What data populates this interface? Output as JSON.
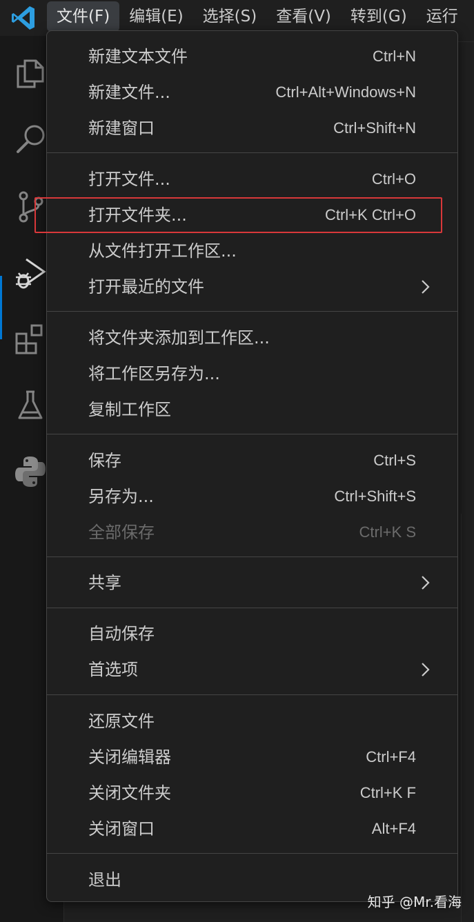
{
  "menubar": {
    "items": [
      {
        "label": "文件(F)",
        "active": true
      },
      {
        "label": "编辑(E)"
      },
      {
        "label": "选择(S)"
      },
      {
        "label": "查看(V)"
      },
      {
        "label": "转到(G)"
      },
      {
        "label": "运行"
      }
    ]
  },
  "activity_icons": [
    "files-icon",
    "search-icon",
    "source-control-icon",
    "run-debug-icon",
    "extensions-icon",
    "testing-flask-icon",
    "python-icon"
  ],
  "file_menu": {
    "items": [
      {
        "label": "新建文本文件",
        "shortcut": "Ctrl+N"
      },
      {
        "label": "新建文件...",
        "shortcut": "Ctrl+Alt+Windows+N"
      },
      {
        "label": "新建窗口",
        "shortcut": "Ctrl+Shift+N"
      },
      {
        "label": "打开文件...",
        "shortcut": "Ctrl+O"
      },
      {
        "label": "打开文件夹...",
        "shortcut": "Ctrl+K Ctrl+O",
        "highlighted": true
      },
      {
        "label": "从文件打开工作区...",
        "shortcut": ""
      },
      {
        "label": "打开最近的文件",
        "shortcut": "",
        "submenu": true
      },
      {
        "label": "将文件夹添加到工作区...",
        "shortcut": ""
      },
      {
        "label": "将工作区另存为...",
        "shortcut": ""
      },
      {
        "label": "复制工作区",
        "shortcut": ""
      },
      {
        "label": "保存",
        "shortcut": "Ctrl+S"
      },
      {
        "label": "另存为...",
        "shortcut": "Ctrl+Shift+S"
      },
      {
        "label": "全部保存",
        "shortcut": "Ctrl+K S",
        "disabled": true
      },
      {
        "label": "共享",
        "shortcut": "",
        "submenu": true
      },
      {
        "label": "自动保存",
        "shortcut": ""
      },
      {
        "label": "首选项",
        "shortcut": "",
        "submenu": true
      },
      {
        "label": "还原文件",
        "shortcut": ""
      },
      {
        "label": "关闭编辑器",
        "shortcut": "Ctrl+F4"
      },
      {
        "label": "关闭文件夹",
        "shortcut": "Ctrl+K F"
      },
      {
        "label": "关闭窗口",
        "shortcut": "Alt+F4"
      },
      {
        "label": "退出",
        "shortcut": ""
      }
    ]
  },
  "colors": {
    "background": "#1f1f1f",
    "accent": "#0078d4",
    "highlight_box": "#d9383a",
    "text": "#cccccc",
    "disabled_text": "#6b6b6b"
  },
  "watermark": "知乎 @Mr.看海"
}
